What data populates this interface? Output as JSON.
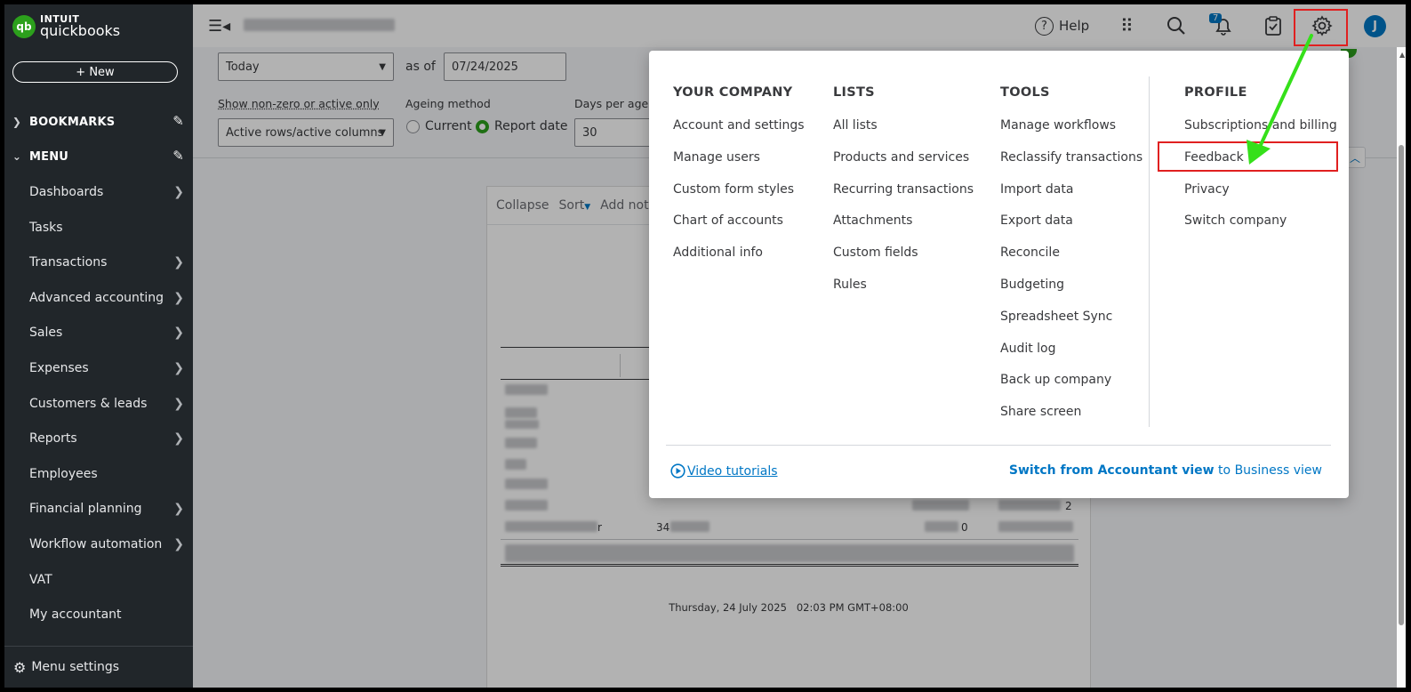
{
  "brand": {
    "badge": "qb",
    "line1": "INTUIT",
    "line2": "quickbooks"
  },
  "sidebar": {
    "new_label": "+ New",
    "bookmarks": "BOOKMARKS",
    "menu": "MENU",
    "items": [
      {
        "label": "Dashboards",
        "arrow": true
      },
      {
        "label": "Tasks",
        "arrow": false
      },
      {
        "label": "Transactions",
        "arrow": true
      },
      {
        "label": "Advanced accounting",
        "arrow": true
      },
      {
        "label": "Sales",
        "arrow": true
      },
      {
        "label": "Expenses",
        "arrow": true
      },
      {
        "label": "Customers & leads",
        "arrow": true
      },
      {
        "label": "Reports",
        "arrow": true
      },
      {
        "label": "Employees",
        "arrow": false
      },
      {
        "label": "Financial planning",
        "arrow": true
      },
      {
        "label": "Workflow automation",
        "arrow": true
      },
      {
        "label": "VAT",
        "arrow": false
      },
      {
        "label": "My accountant",
        "arrow": false
      }
    ],
    "footer": "Menu settings"
  },
  "topbar": {
    "help": "Help",
    "notification_count": "7",
    "avatar_initial": "J"
  },
  "report": {
    "period": "Today",
    "as_of_label": "as of",
    "as_of_date": "07/24/2025",
    "show_label": "Show non-zero or active only",
    "show_value": "Active rows/active columns",
    "ageing_label": "Ageing method",
    "ageing_current": "Current",
    "ageing_report_date": "Report date",
    "days_label": "Days per agein",
    "days_value": "30",
    "collapse": "Collapse",
    "sort": "Sort",
    "add_note": "Add note",
    "row_value_1": "34",
    "row_value_2": "0",
    "row_value_3": "2",
    "row_suffix": "r",
    "timestamp": "Thursday, 24 July 2025   02:03 PM GMT+08:00"
  },
  "gear_menu": {
    "columns": [
      {
        "header": "YOUR COMPANY",
        "items": [
          "Account and settings",
          "Manage users",
          "Custom form styles",
          "Chart of accounts",
          "Additional info"
        ]
      },
      {
        "header": "LISTS",
        "items": [
          "All lists",
          "Products and services",
          "Recurring transactions",
          "Attachments",
          "Custom fields",
          "Rules"
        ]
      },
      {
        "header": "TOOLS",
        "items": [
          "Manage workflows",
          "Reclassify transactions",
          "Import data",
          "Export data",
          "Reconcile",
          "Budgeting",
          "Spreadsheet Sync",
          "Audit log",
          "Back up company",
          "Share screen"
        ]
      },
      {
        "header": "PROFILE",
        "items": [
          "Subscriptions and billing",
          "Feedback",
          "Privacy",
          "Switch company"
        ]
      }
    ],
    "video_tutorials": "Video tutorials",
    "switch_bold": "Switch from Accountant view",
    "switch_rest": " to Business view"
  },
  "colors": {
    "brand_green": "#2ca01c",
    "link_blue": "#0077c5",
    "highlight_red": "#e02020",
    "arrow_green": "#35e01a"
  }
}
